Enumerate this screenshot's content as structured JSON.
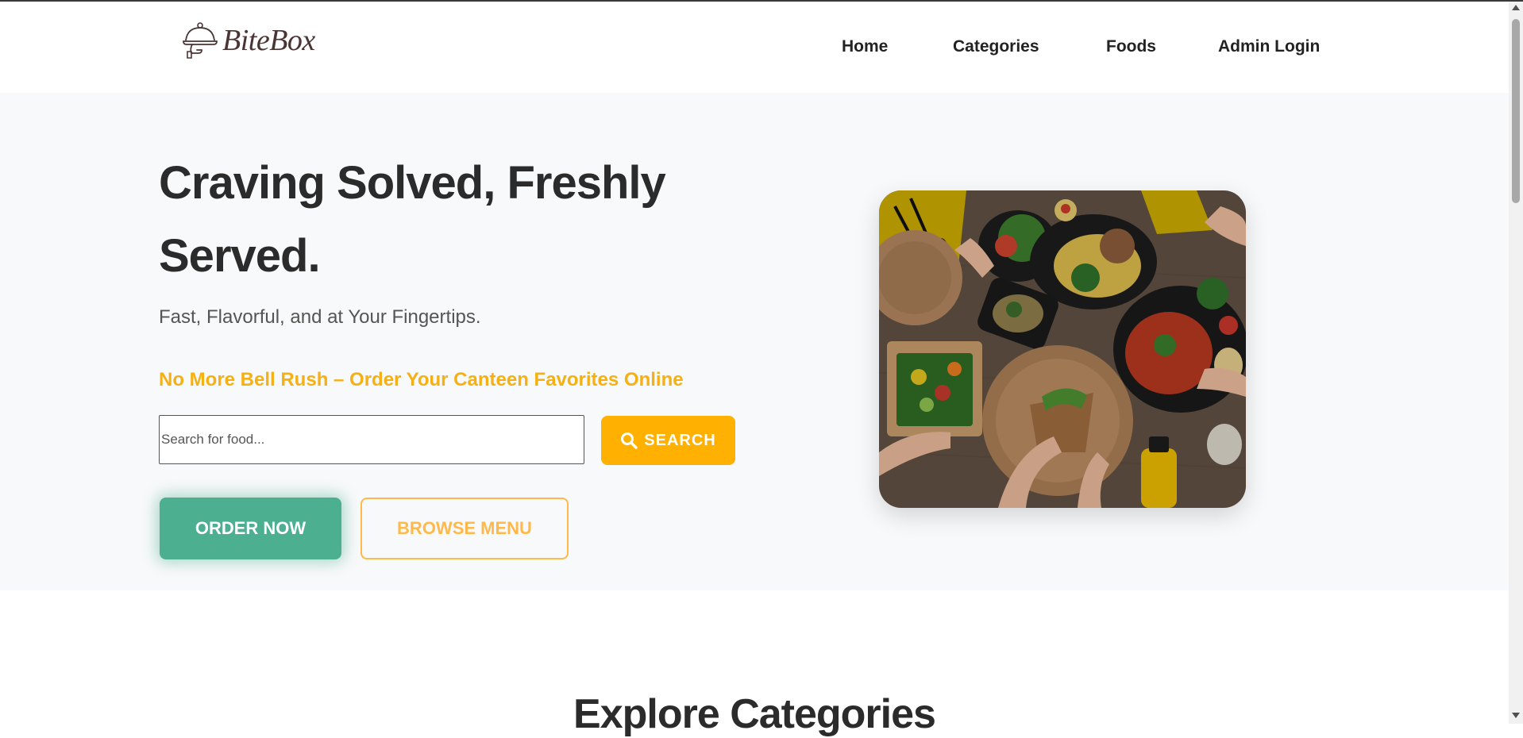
{
  "brand": {
    "name": "BiteBox",
    "logo_icon": "cloche-icon"
  },
  "nav": {
    "items": [
      {
        "label": "Home"
      },
      {
        "label": "Categories"
      },
      {
        "label": "Foods"
      },
      {
        "label": "Admin Login"
      }
    ]
  },
  "hero": {
    "title": "Craving Solved, Freshly Served.",
    "subtitle": "Fast, Flavorful, and at Your Fingertips.",
    "tagline": "No More Bell Rush – Order Your Canteen Favorites Online",
    "search": {
      "placeholder": "Search for food...",
      "value": "",
      "button_label": "SEARCH",
      "icon": "search-icon"
    },
    "order_button": "ORDER NOW",
    "browse_button": "BROWSE MENU",
    "image": "food-spread-photo"
  },
  "categories_section": {
    "title": "Explore Categories"
  },
  "colors": {
    "accent_yellow": "#ffb000",
    "accent_green": "#4caf8f",
    "tagline_yellow": "#f5b014",
    "text_dark": "#2b2b2b",
    "hero_bg": "#f8f9fa"
  }
}
